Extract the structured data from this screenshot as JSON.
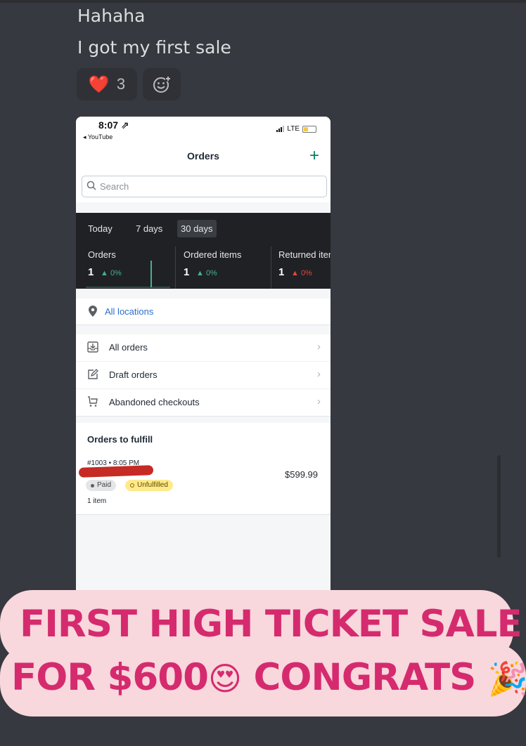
{
  "chat": {
    "message_1": "Hahaha",
    "message_2": "I got my first sale",
    "reactions": [
      {
        "emoji": "❤️",
        "count": "3"
      },
      {
        "icon": "add-reaction-icon"
      }
    ]
  },
  "phone": {
    "status_bar": {
      "time": "8:07 ⇗",
      "back_app": "◂ YouTube",
      "network": "LTE"
    },
    "nav": {
      "title": "Orders",
      "add_symbol": "+"
    },
    "search": {
      "placeholder": "Search"
    },
    "date_tabs": [
      "Today",
      "7 days",
      "30 days"
    ],
    "active_tab": "30 days",
    "stats": [
      {
        "label": "Orders",
        "value": "1",
        "change": "▲ 0%",
        "color": "#48b089"
      },
      {
        "label": "Ordered items",
        "value": "1",
        "change": "▲ 0%",
        "color": "#48b089"
      },
      {
        "label": "Returned items",
        "value": "1",
        "change": "▲ 0%",
        "color": "#e0483c"
      }
    ],
    "locations": {
      "label": "All locations"
    },
    "menu": [
      {
        "label": "All orders",
        "icon": "inbox-icon"
      },
      {
        "label": "Draft orders",
        "icon": "edit-icon"
      },
      {
        "label": "Abandoned checkouts",
        "icon": "cart-icon"
      }
    ],
    "orders_to_fulfill": {
      "title": "Orders to fulfill",
      "order": {
        "id_time": "#1003 • 8:05 PM",
        "price": "$599.99",
        "payment_badge": "Paid",
        "fulfillment_badge": "Unfulfilled",
        "items": "1 item"
      }
    }
  },
  "caption": {
    "line_1": "FIRST HIGH TICKET SALE",
    "line_2_a": "FOR $600",
    "line_2_emoji": "😍",
    "line_2_b": " CONGRATS ",
    "line_2_emoji_2": "🎉"
  },
  "colors": {
    "discord_bg": "#36393f",
    "shopify_green": "#008060",
    "caption_bg": "#f8d7dd",
    "caption_text": "#d52b6e",
    "link_blue": "#2c6ecb"
  }
}
